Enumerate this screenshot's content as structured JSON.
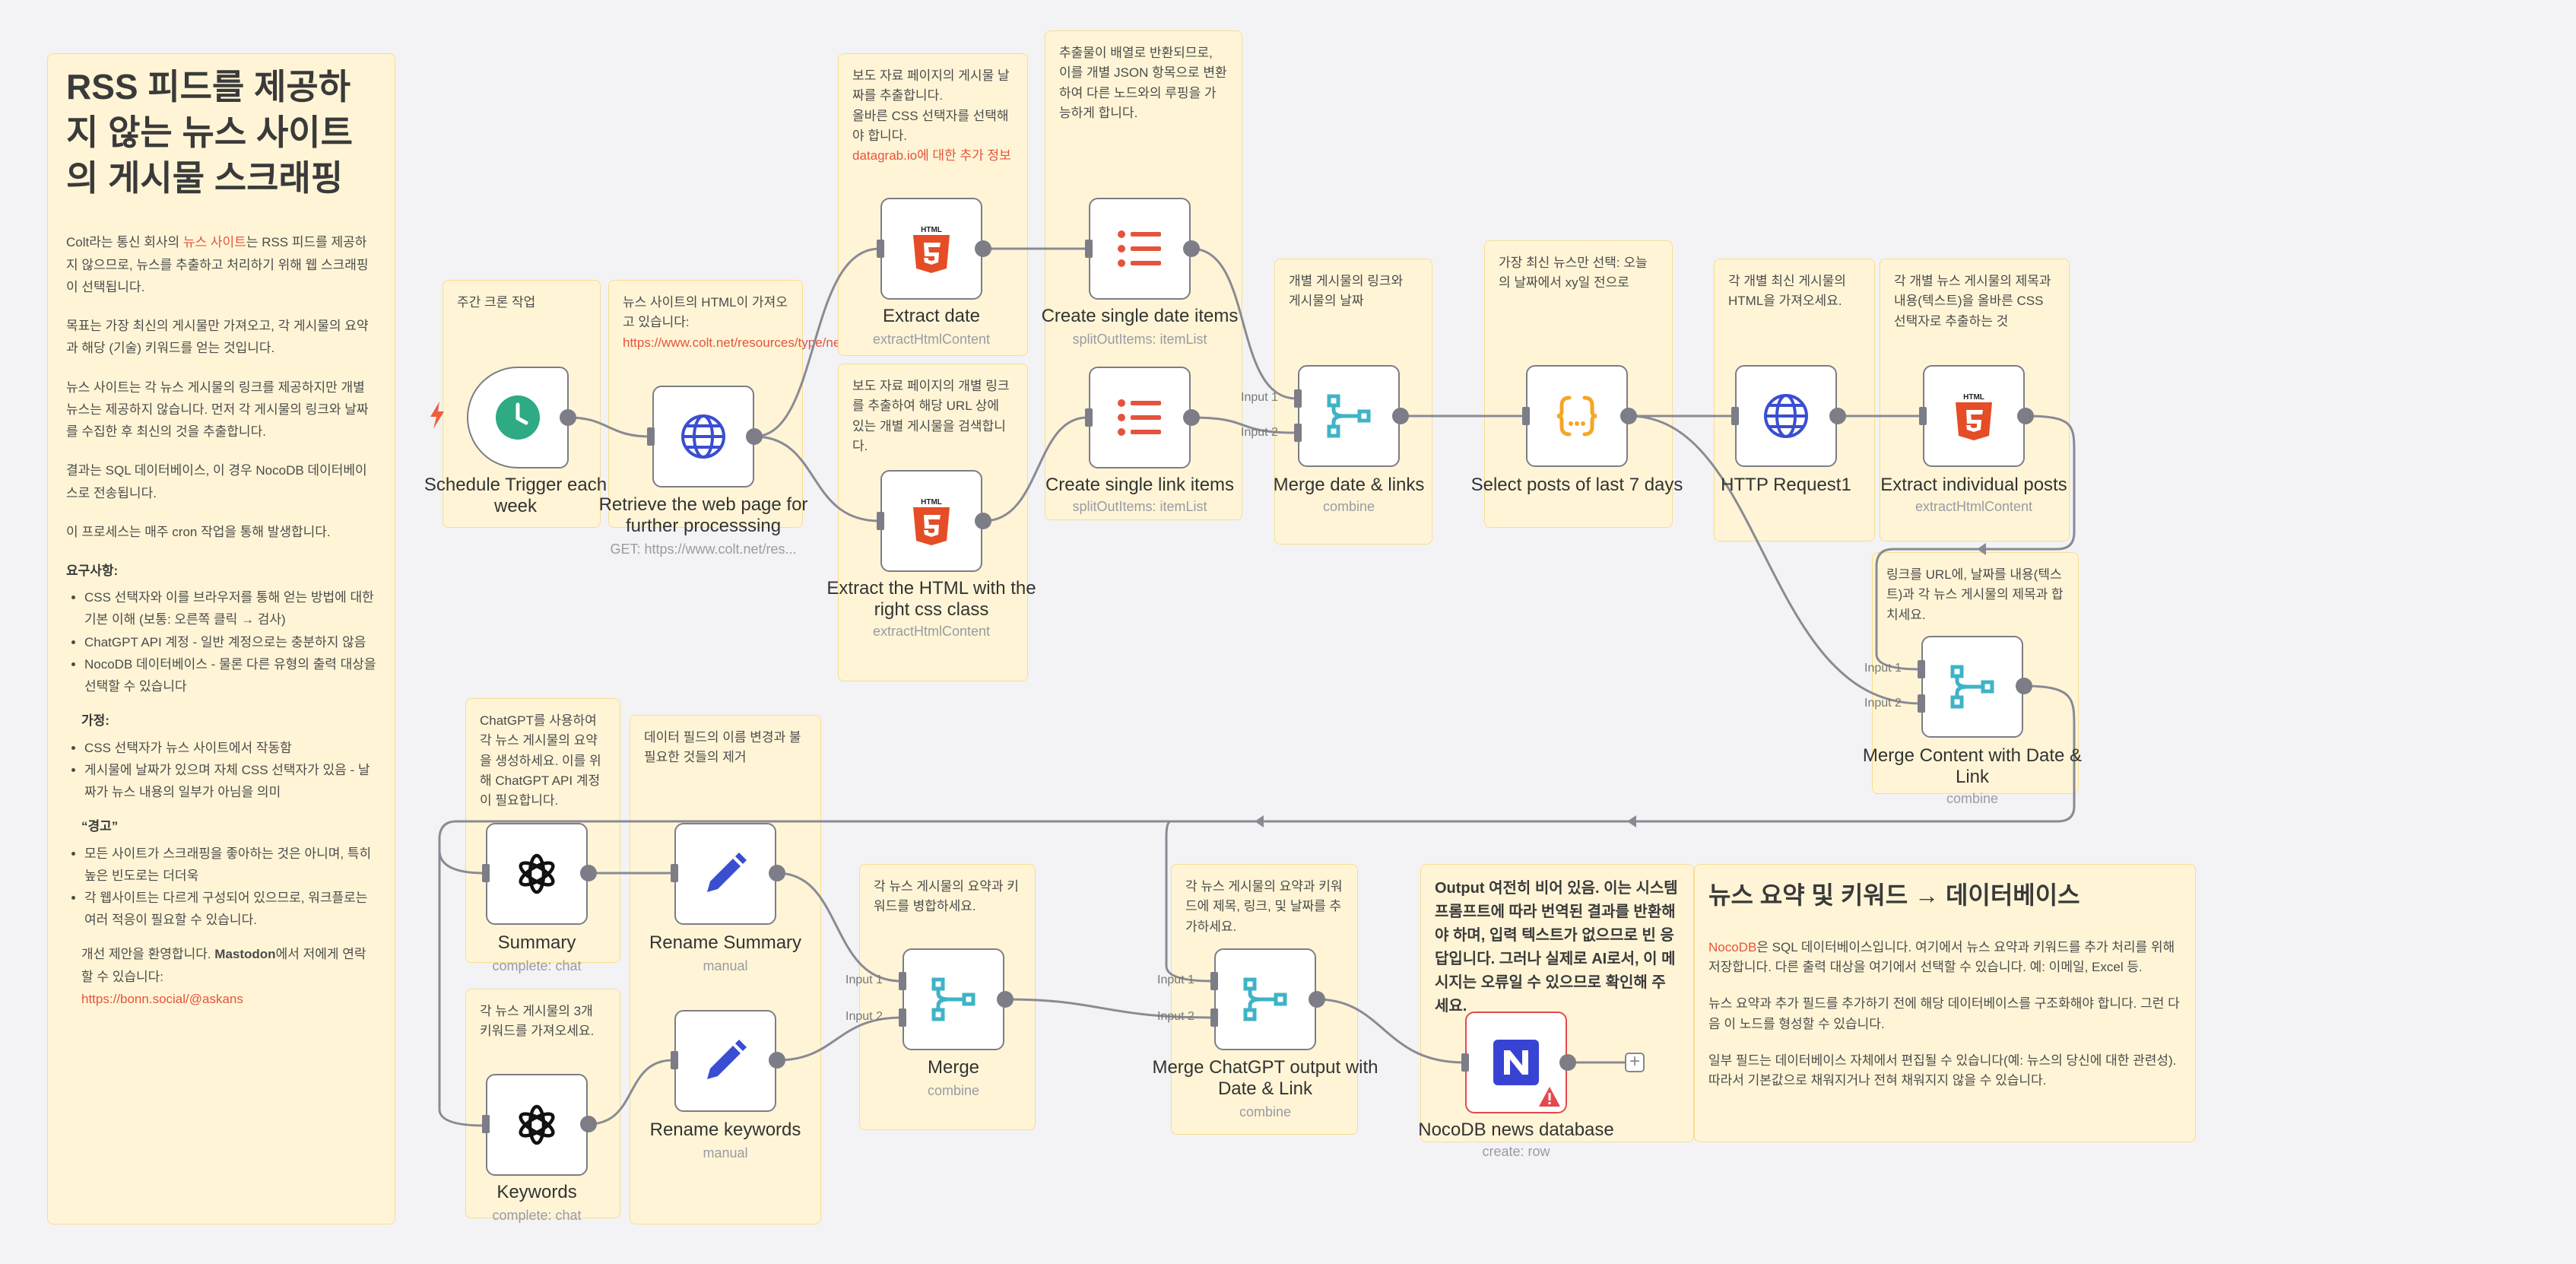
{
  "notes": {
    "main": {
      "title": "RSS 피드를 제공하지 않는 뉴스 사이트의 게시물 스크래핑",
      "p1_pre": "Colt라는 통신 회사의 ",
      "p1_link": "뉴스 사이트",
      "p1_post": "는 RSS 피드를 제공하지 않으므로, 뉴스를 추출하고 처리하기 위해 웹 스크래핑이 선택됩니다.",
      "p2": "목표는 가장 최신의 게시물만 가져오고, 각 게시물의 요약과 해당 (기술) 키워드를 얻는 것입니다.",
      "p3": "뉴스 사이트는 각 뉴스 게시물의 링크를 제공하지만 개별 뉴스는 제공하지 않습니다. 먼저 각 게시물의 링크와 날짜를 수집한 후 최신의 것을 추출합니다.",
      "p4": "결과는 SQL 데이터베이스, 이 경우 NocoDB 데이터베이스로 전송됩니다.",
      "p5": "이 프로세스는 매주 cron 작업을 통해 발생합니다.",
      "req_title": "요구사항:",
      "req1": "CSS 선택자와 이를 브라우저를 통해 얻는 방법에 대한 기본 이해 (보통: 오른쪽 클릭 → 검사)",
      "req2": "ChatGPT API 계정 - 일반 계정으로는 충분하지 않음",
      "req3": "NocoDB 데이터베이스 - 물론 다른 유형의 출력 대상을 선택할 수 있습니다",
      "assume_title": "가정:",
      "assume1": "CSS 선택자가 뉴스 사이트에서 작동함",
      "assume2": "게시물에 날짜가 있으며 자체 CSS 선택자가 있음 - 날짜가 뉴스 내용의 일부가 아님을 의미",
      "warn_title": "“경고”",
      "warn1": "모든 사이트가 스크래핑을 좋아하는 것은 아니며, 특히 높은 빈도로는 더더욱",
      "warn2": "각 웹사이트는 다르게 구성되어 있으므로, 워크플로는 여러 적응이 필요할 수 있습니다.",
      "contact_pre": "개선 제안을 환영합니다. ",
      "contact_bold": "Mastodon",
      "contact_post": "에서 저에게 연락할 수 있습니다:",
      "contact_link": "https://bonn.social/@askans"
    },
    "weekly": "주간 크론 작업",
    "retrieve": "뉴스 사이트의 HTML이 가져오고 있습니다:",
    "retrieve_link": "https://www.colt.net/resources/type/news/",
    "date_sel": "보도 자료 페이지의 게시물 날짜를 추출합니다.\n올바른 CSS 선택자를 선택해야 합니다.",
    "date_sel_link": "datagrab.io에 대한 추가 정보",
    "link_sel": "보도 자료 페이지의 개별 링크를 추출하여 해당 URL 상에 있는 개별 게시물을 검색합니다.",
    "split": "추출물이 배열로 반환되므로, 이를 개별 JSON 항목으로 변환하여 다른 노드와의 루핑을 가능하게 합니다.",
    "link_date": "개별 게시물의 링크와 게시물의 날짜",
    "latest": "가장 최신 뉴스만 선택: 오늘의 날짜에서 xy일 전으로",
    "fetch_each": "각 개별 최신 게시물의 HTML을 가져오세요.",
    "extract_each": "각 개별 뉴스 게시물의 제목과 내용(텍스트)을 올바른 CSS 선택자로 추출하는 것",
    "merge_url": "링크를 URL에, 날짜를 내용(텍스트)과 각 뉴스 게시물의 제목과 합치세요.",
    "gpt_summary": "ChatGPT를 사용하여 각 뉴스 게시물의 요약을 생성하세요. 이를 위해 ChatGPT API 계정이 필요합니다.",
    "rename": "데이터 필드의 이름 변경과 불필요한 것들의 제거",
    "keywords3": "각 뉴스 게시물의 3개 키워드를 가져오세요.",
    "merge_sum_kw": "각 뉴스 게시물의 요약과 키워드를 병합하세요.",
    "merge_all": "각 뉴스 게시물의 요약과 키워드에 제목, 링크, 및 날짜를 추가하세요.",
    "output_warn": "Output 여전히 비어 있음. 이는 시스템 프롬프트에 따라 번역된 결과를 반환해야 하며, 입력 텍스트가 없으므로 빈 응답입니다. 그러나 실제로 AI로서, 이 메시지는 오류일 수 있으므로 확인해 주세요.",
    "db": {
      "title": "뉴스 요약 및 키워드 → 데이터베이스",
      "p1_link": "NocoDB",
      "p1_post": "은 SQL 데이터베이스입니다. 여기에서 뉴스 요약과 키워드를 추가 처리를 위해 저장합니다. 다른 출력 대상을 여기에서 선택할 수 있습니다. 예: 이메일, Excel 등.",
      "p2": "뉴스 요약과 추가 필드를 추가하기 전에 해당 데이터베이스를 구조화해야 합니다. 그런 다음 이 노드를 형성할 수 있습니다.",
      "p3": "일부 필드는 데이터베이스 자체에서 편집될 수 있습니다(예: 뉴스의 당신에 대한 관련성). 따라서 기본값으로 채워지거나 전혀 채워지지 않을 수 있습니다."
    }
  },
  "nodes": {
    "schedule": {
      "label": "Schedule Trigger each week",
      "icon": "clock-icon"
    },
    "retrieve": {
      "label": "Retrieve the web page for further processsing",
      "sub": "GET: https://www.colt.net/res...",
      "icon": "globe-icon"
    },
    "extract_date": {
      "label": "Extract date",
      "sub": "extractHtmlContent",
      "icon": "html5-icon"
    },
    "extract_html": {
      "label": "Extract the HTML with the right css class",
      "sub": "extractHtmlContent",
      "icon": "html5-icon"
    },
    "date_items": {
      "label": "Create single date items",
      "sub": "splitOutItems: itemList",
      "icon": "list-icon"
    },
    "link_items": {
      "label": "Create single link items",
      "sub": "splitOutItems: itemList",
      "icon": "list-icon"
    },
    "merge_date_links": {
      "label": "Merge date & links",
      "sub": "combine",
      "icon": "merge-icon"
    },
    "select_posts": {
      "label": "Select posts of last 7 days",
      "icon": "code-braces-icon"
    },
    "http_request": {
      "label": "HTTP Request1",
      "icon": "globe-icon"
    },
    "extract_posts": {
      "label": "Extract individual posts",
      "sub": "extractHtmlContent",
      "icon": "html5-icon"
    },
    "merge_content": {
      "label": "Merge Content with Date & Link",
      "sub": "combine",
      "icon": "merge-icon"
    },
    "summary": {
      "label": "Summary",
      "sub": "complete: chat",
      "icon": "openai-icon"
    },
    "keywords": {
      "label": "Keywords",
      "sub": "complete: chat",
      "icon": "openai-icon"
    },
    "rename_summary": {
      "label": "Rename Summary",
      "sub": "manual",
      "icon": "pencil-icon"
    },
    "rename_keywords": {
      "label": "Rename keywords",
      "sub": "manual",
      "icon": "pencil-icon"
    },
    "merge": {
      "label": "Merge",
      "sub": "combine",
      "icon": "merge-icon"
    },
    "merge_chatgpt": {
      "label": "Merge ChatGPT output with Date & Link",
      "sub": "combine",
      "icon": "merge-icon"
    },
    "nocodb": {
      "label": "NocoDB news database",
      "sub": "create: row",
      "icon": "nocodb-icon"
    }
  },
  "input_labels": {
    "in1": "Input 1",
    "in2": "Input 2"
  },
  "plus_symbol": "+",
  "colors": {
    "accent": "#e5533c",
    "sticky_bg": "#fff5d6",
    "sticky_border": "#f7dd92",
    "node_border": "#7d7d87",
    "wire": "#8a8a95",
    "error": "#e5484d"
  }
}
